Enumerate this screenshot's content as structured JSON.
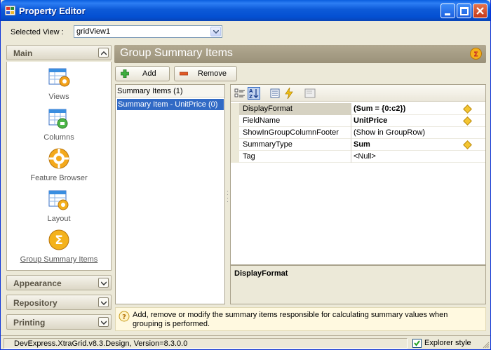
{
  "window": {
    "title": "Property Editor"
  },
  "selected_view": {
    "label": "Selected View :",
    "value": "gridView1"
  },
  "nav": {
    "main_label": "Main",
    "items": [
      {
        "label": "Views",
        "icon": "views-icon"
      },
      {
        "label": "Columns",
        "icon": "columns-icon"
      },
      {
        "label": "Feature Browser",
        "icon": "gear-icon"
      },
      {
        "label": "Layout",
        "icon": "layout-icon"
      },
      {
        "label": "Group Summary Items",
        "icon": "sigma-icon"
      }
    ],
    "sections": [
      "Appearance",
      "Repository",
      "Printing"
    ]
  },
  "content": {
    "title": "Group Summary Items",
    "add_label": "Add",
    "remove_label": "Remove",
    "list_header": "Summary Items (1)",
    "list_items": [
      "Summary Item - UnitPrice (0)"
    ],
    "properties": [
      {
        "name": "DisplayFormat",
        "value": "(Sum = {0:c2})",
        "bold": true,
        "modified": true
      },
      {
        "name": "FieldName",
        "value": "UnitPrice",
        "bold": true,
        "modified": true
      },
      {
        "name": "ShowInGroupColumnFooter",
        "value": "(Show in GroupRow)",
        "bold": false,
        "modified": false
      },
      {
        "name": "SummaryType",
        "value": "Sum",
        "bold": true,
        "modified": true
      },
      {
        "name": "Tag",
        "value": "<Null>",
        "bold": false,
        "modified": false
      }
    ],
    "description_title": "DisplayFormat",
    "hint": "Add, remove or modify the summary items responsible for calculating summary values when grouping is performed."
  },
  "status": {
    "version": "DevExpress.XtraGrid.v8.3.Design, Version=8.3.0.0",
    "explorer_label": "Explorer style",
    "explorer_checked": true
  },
  "colors": {
    "titlebar": "#0a5fde",
    "selection": "#316ac5",
    "header": "#a89f87"
  }
}
